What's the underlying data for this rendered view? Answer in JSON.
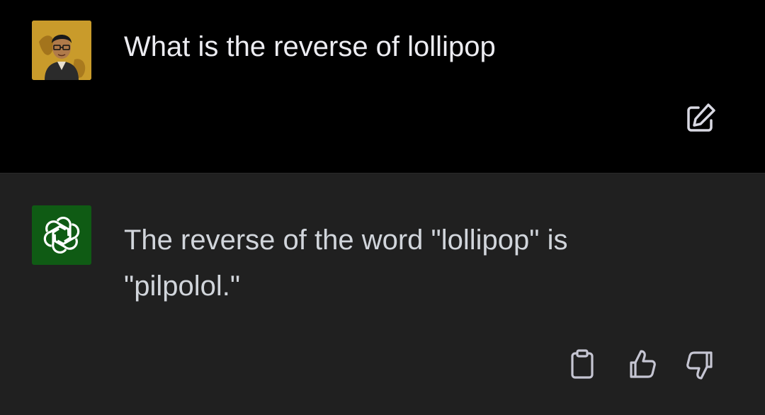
{
  "conversation": {
    "user": {
      "avatar_icon": "user-avatar-photo",
      "message": "What is the reverse of lollipop",
      "edit_icon": "edit-icon"
    },
    "assistant": {
      "avatar_icon": "openai-logo-icon",
      "message": "The reverse of the word \"lollipop\" is \"pilpolol.\"",
      "actions": {
        "copy_icon": "clipboard-icon",
        "like_icon": "thumbs-up-icon",
        "dislike_icon": "thumbs-down-icon"
      }
    }
  },
  "colors": {
    "user_background": "#000000",
    "assistant_background": "#202020",
    "assistant_avatar_background": "#0f5b14",
    "text": "#ececf1"
  }
}
